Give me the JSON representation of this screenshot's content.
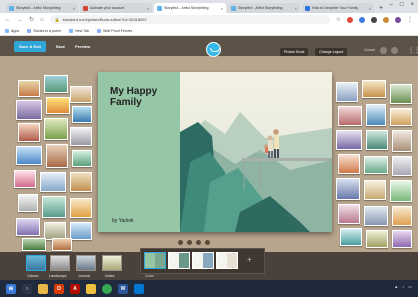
{
  "browser": {
    "tabs": [
      {
        "label": "Storybird - Artful Storytelling",
        "color": "#5eb4e6",
        "active": false
      },
      {
        "label": "Activate your account",
        "color": "#d44638",
        "active": false
      },
      {
        "label": "Storybird - Artful Storytelling",
        "color": "#5eb4e6",
        "active": true
      },
      {
        "label": "Storybird - Artful Storytelling",
        "color": "#5eb4e6",
        "active": false
      },
      {
        "label": "How to Describe Your Family",
        "color": "#2b78e4",
        "active": false
      }
    ],
    "new_tab": "+",
    "url": "storybird.com/pictureBook-editor/?id=36318057",
    "bookmarks": [
      "Apps",
      "Stories in a poem",
      "New Tab",
      "Wolf Proof Ferrets"
    ]
  },
  "toolbar": {
    "save_exit": "Save & Exit",
    "save": "Save",
    "preview": "Preview",
    "picture_book": "Picture Book",
    "change_layout": "Change Layout",
    "cancel": "Cancel"
  },
  "book": {
    "title": "My Happy Family",
    "author": "by Yaniok"
  },
  "layouts": [
    {
      "label": "Classic"
    },
    {
      "label": "Landscape"
    },
    {
      "label": "Journal"
    },
    {
      "label": "Notes"
    }
  ],
  "pages": {
    "cover_label": "Cover",
    "add": "+"
  },
  "colors": {
    "accent": "#2fa7d9",
    "cork": "#b8a58e",
    "toolbar": "#5c5247",
    "cover": "#95c6a5"
  }
}
